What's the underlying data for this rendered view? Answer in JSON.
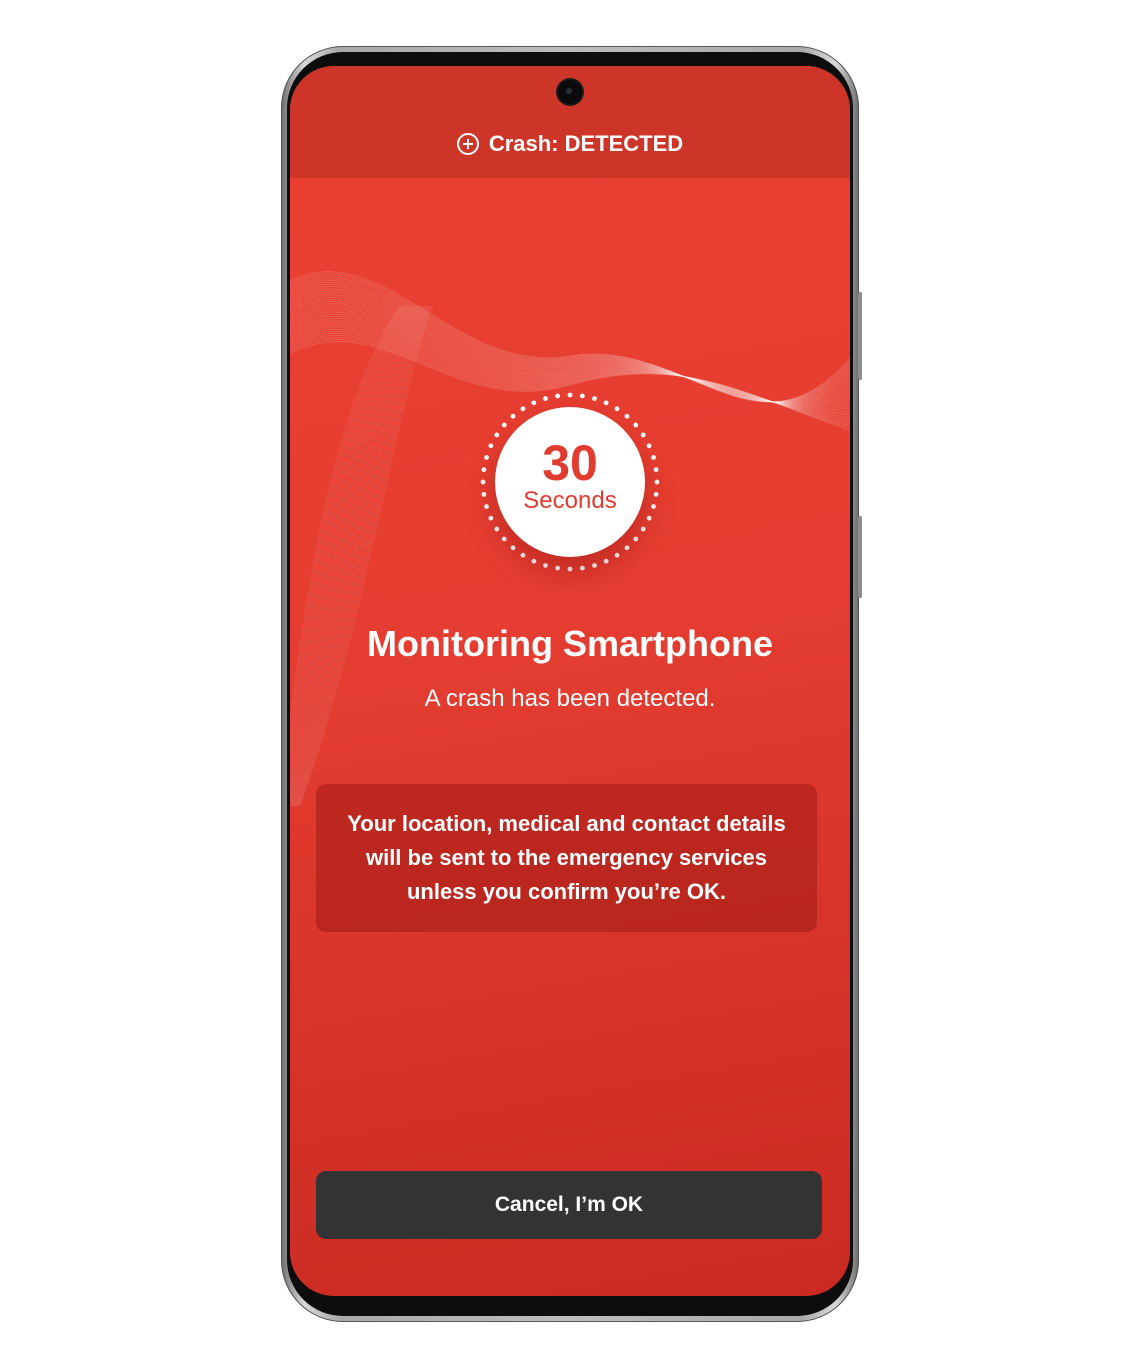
{
  "status_bar": {
    "icon": "plus-circle-icon",
    "text": "Crash: DETECTED"
  },
  "timer": {
    "value": "30",
    "unit": "Seconds"
  },
  "main": {
    "title": "Monitoring Smartphone",
    "subtitle": "A crash has been detected.",
    "notice": "Your location, medical and contact details will be sent to the emergency services unless you confirm you’re OK."
  },
  "actions": {
    "cancel_label": "Cancel, I’m OK"
  },
  "colors": {
    "screen_background": "#e53d31",
    "status_bar": "#ce3529",
    "timer_text": "#e23b2f",
    "button_background": "#333333"
  }
}
